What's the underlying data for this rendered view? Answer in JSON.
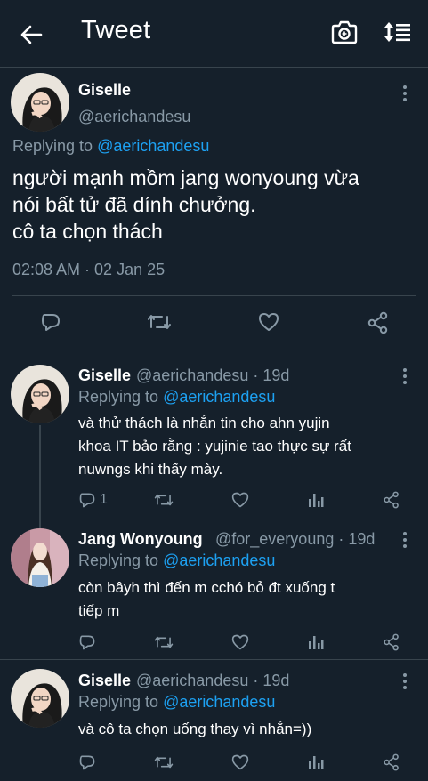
{
  "header": {
    "title": "Tweet",
    "back_icon": "arrow-left-icon",
    "camera_icon": "camera-icon",
    "sort_icon": "sort-icon"
  },
  "main_tweet": {
    "name": "Giselle",
    "handle": "@aerichandesu",
    "replying_prefix": "Replying to ",
    "replying_to": "@aerichandesu",
    "text_lines": [
      "người mạnh mồm jang wonyoung vừa",
      "nói bất tử đã dính chưởng.",
      "cô ta chọn thách"
    ],
    "timestamp": "02:08 AM · 02 Jan 25"
  },
  "replies": [
    {
      "name": "Giselle",
      "handle": "@aerichandesu · 19d",
      "replying_prefix": "Replying to ",
      "replying_to": "@aerichandesu",
      "text_lines": [
        "và thử thách là nhắn tin cho ahn yujin",
        "khoa IT bảo rằng : yujinie tao thực sự rất",
        "nuwngs khi thấy mày."
      ],
      "reply_count": "1"
    },
    {
      "name": "Jang Wonyoung",
      "handle": "@for_everyoung · 19d",
      "replying_prefix": "Replying to ",
      "replying_to": "@aerichandesu",
      "text_lines": [
        "còn bâyh thì đến m cchó bỏ đt xuống t",
        "tiếp m"
      ],
      "reply_count": ""
    },
    {
      "name": "Giselle",
      "handle": "@aerichandesu · 19d",
      "replying_prefix": "Replying to ",
      "replying_to": "@aerichandesu",
      "text_lines": [
        "và cô ta chọn uống thay vì nhắn=))"
      ],
      "reply_count": ""
    }
  ],
  "colors": {
    "background": "#15202b",
    "secondary_text": "#8899a6",
    "accent": "#1da1f2",
    "divider": "#38444d"
  }
}
